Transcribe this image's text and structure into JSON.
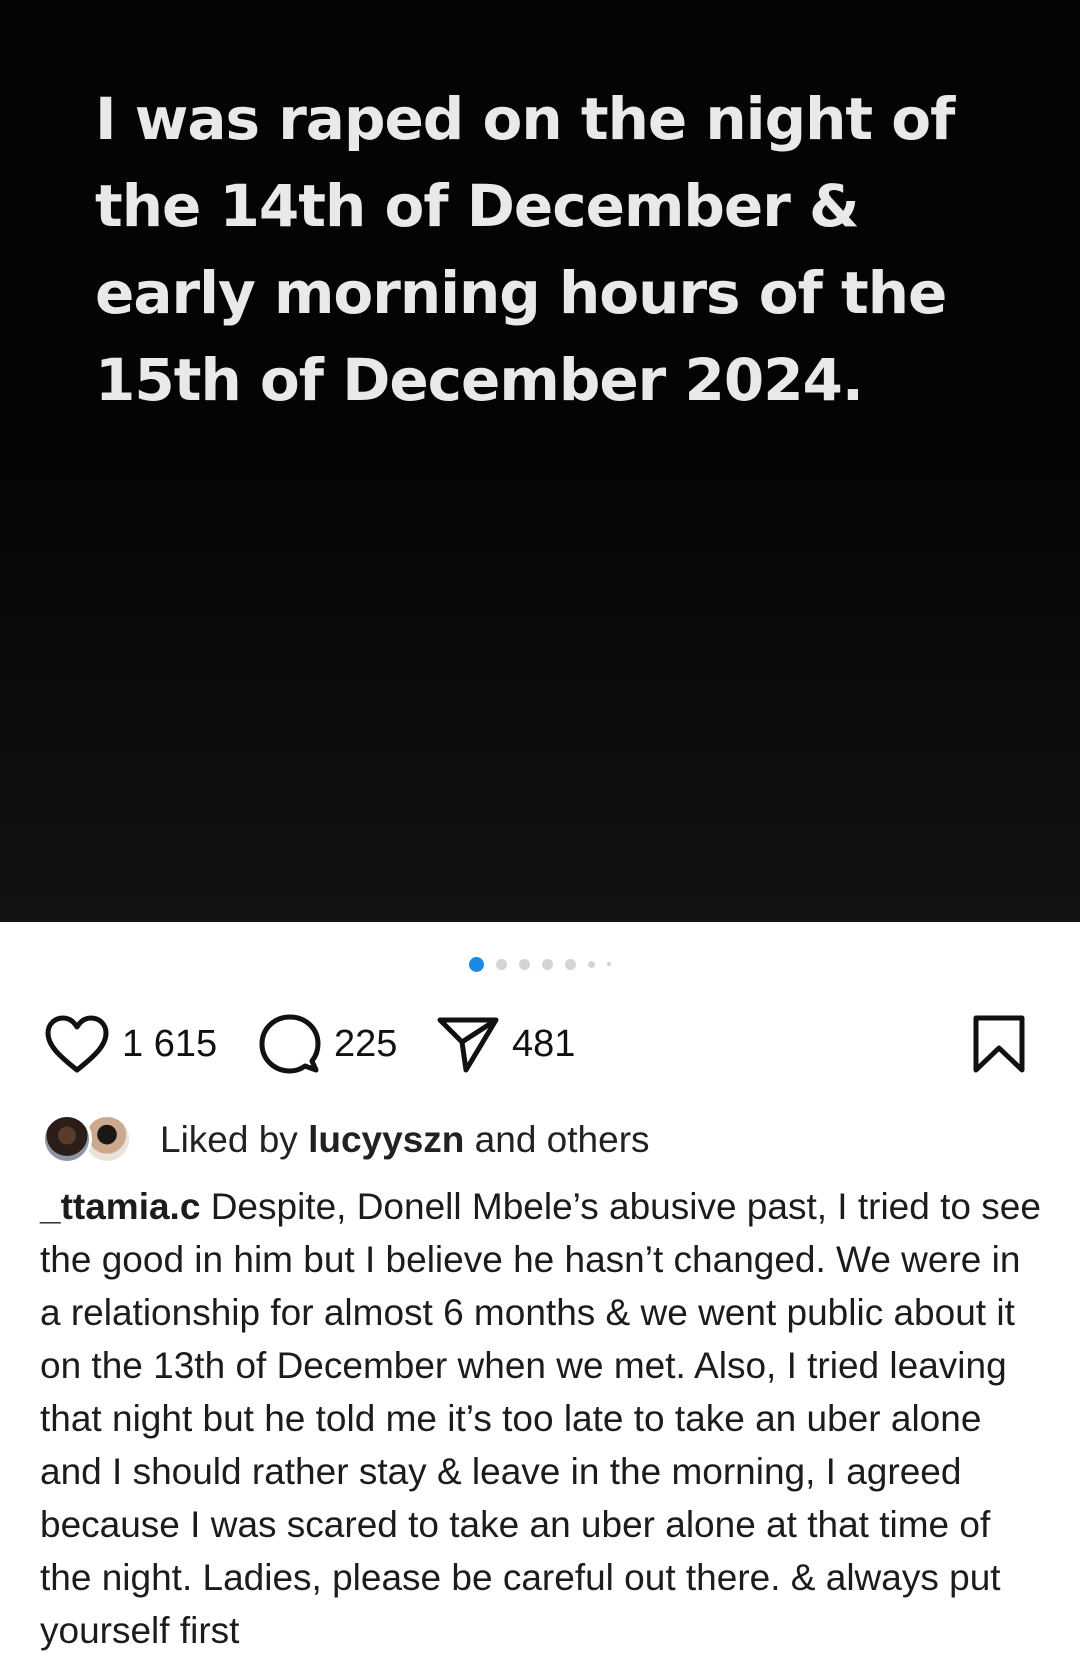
{
  "post": {
    "media_text": "I was raped on the night of the 14th of December & early morning hours of the 15th of December 2024.",
    "carousel": {
      "total": 7,
      "active_index": 0
    }
  },
  "actions": {
    "likes": "1 615",
    "comments": "225",
    "shares": "481"
  },
  "liked_by": {
    "prefix": "Liked by",
    "user": "lucyyszn",
    "suffix": "and others"
  },
  "caption": {
    "username": "_ttamia.c",
    "text": "Despite, Donell Mbele’s abusive past, I tried to see the good in him but I believe he hasn’t changed. We were in a relationship for almost 6 months & we went public about it on the 13th of December when we met. Also, I tried leaving that night but he told me it’s too late to take an uber alone and I should rather stay & leave in the morning, I agreed because I was scared to take an uber alone at that time of the night. Ladies, please be careful out there. & always put yourself first"
  },
  "colors": {
    "accent": "#1e88e5",
    "media_background": "#040404",
    "media_text": "#e9e9e9"
  },
  "icons": [
    "heart-icon",
    "comment-icon",
    "share-icon",
    "bookmark-icon"
  ]
}
